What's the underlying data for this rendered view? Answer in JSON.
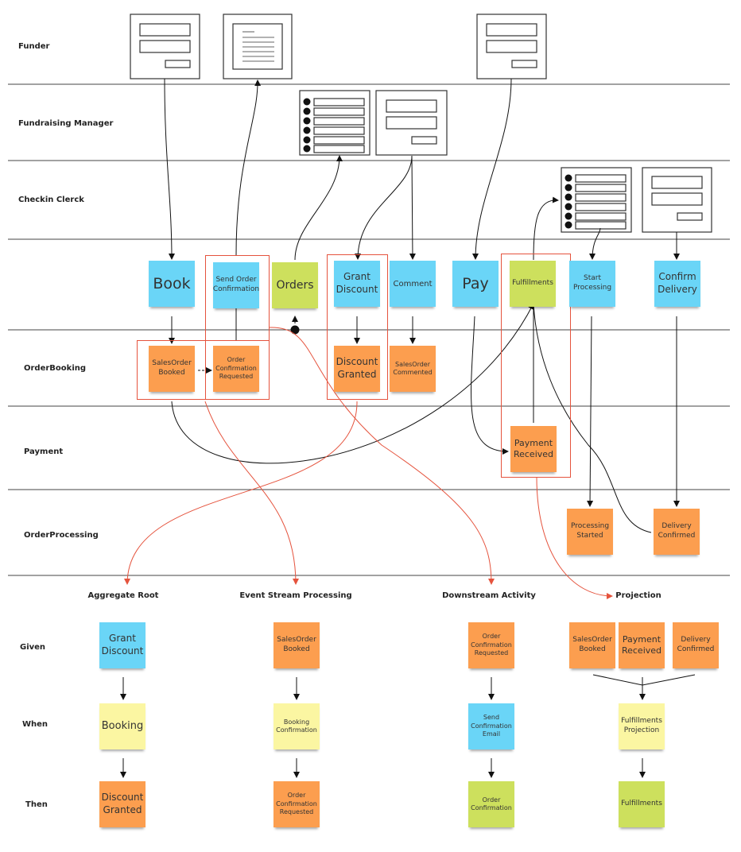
{
  "colors": {
    "command": "#6ad5f7",
    "event": "#fc9e4f",
    "read_model": "#cde05d",
    "policy": "#fbf6a2",
    "highlight": "#e5533d"
  },
  "lanes": [
    "Funder",
    "Fundraising Manager",
    "Checkin Clerck",
    "OrderBooking",
    "Payment",
    "OrderProcessing"
  ],
  "stickies": {
    "book": "Book",
    "send_order_confirmation": "Send Order Confirmation",
    "orders": "Orders",
    "grant_discount": "Grant Discount",
    "comment": "Comment",
    "pay": "Pay",
    "fulfillments": "Fulfillments",
    "start_processing": "Start Processing",
    "confirm_delivery": "Confirm Delivery",
    "salesorder_booked": "SalesOrder Booked",
    "order_confirmation_requested": "Order Confirmation Requested",
    "discount_granted": "Discount Granted",
    "salesorder_commented": "SalesOrder Commented",
    "payment_received": "Payment Received",
    "processing_started": "Processing Started",
    "delivery_confirmed": "Delivery Confirmed"
  },
  "scenarios": {
    "row_labels": [
      "Given",
      "When",
      "Then"
    ],
    "columns": [
      {
        "title": "Aggregate Root",
        "given": [
          "Grant Discount"
        ],
        "when": "Booking",
        "then": "Discount Granted"
      },
      {
        "title": "Event Stream Processing",
        "given": [
          "SalesOrder Booked"
        ],
        "when": "Booking Confirmation",
        "then": "Order Confirmation Requested"
      },
      {
        "title": "Downstream Activity",
        "given": [
          "Order Confirmation Requested"
        ],
        "when": "Send Confirmation Email",
        "then": "Order Confirmation"
      },
      {
        "title": "Projection",
        "given": [
          "SalesOrder Booked",
          "Payment Received",
          "Delivery Confirmed"
        ],
        "when": "Fulfillments Projection",
        "then": "Fulfillments"
      }
    ]
  }
}
